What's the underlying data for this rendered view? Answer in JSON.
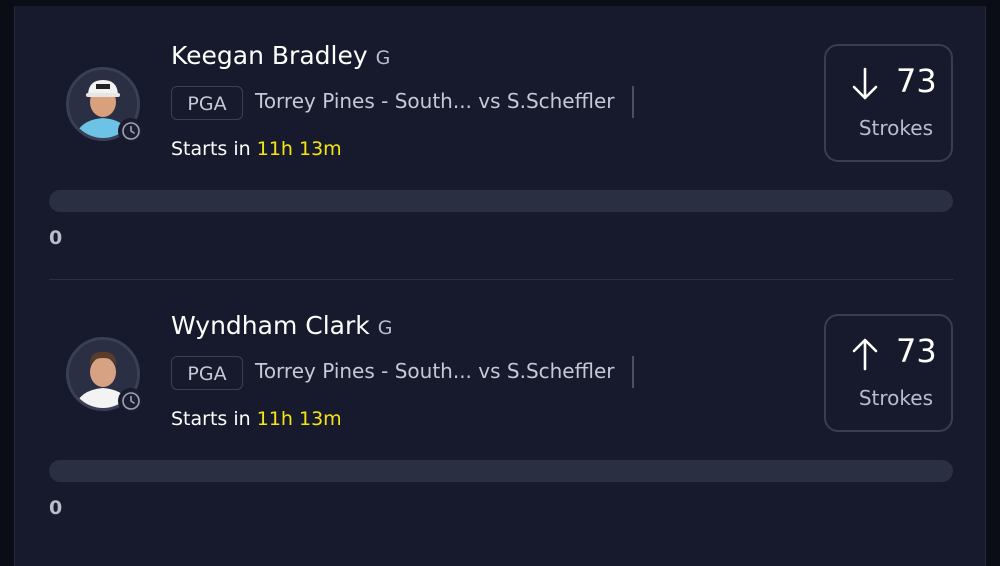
{
  "players": [
    {
      "name": "Keegan Bradley",
      "position": "G",
      "league": "PGA",
      "matchup": "Torrey Pines - South... vs S.Scheffler",
      "starts_label": "Starts in",
      "starts_time": "11h 13m",
      "direction": "down",
      "arrow_icon": "arrow-down-icon",
      "stat_value": "73",
      "stat_label": "Strokes",
      "progress_value": "0",
      "progress_fraction": 0
    },
    {
      "name": "Wyndham Clark",
      "position": "G",
      "league": "PGA",
      "matchup": "Torrey Pines - South... vs S.Scheffler",
      "starts_label": "Starts in",
      "starts_time": "11h 13m",
      "direction": "up",
      "arrow_icon": "arrow-up-icon",
      "stat_value": "73",
      "stat_label": "Strokes",
      "progress_value": "0",
      "progress_fraction": 0
    }
  ],
  "colors": {
    "background": "#171a2c",
    "accent_time": "#f4e514",
    "text_primary": "#ffffff",
    "text_secondary": "#b8bccb"
  }
}
